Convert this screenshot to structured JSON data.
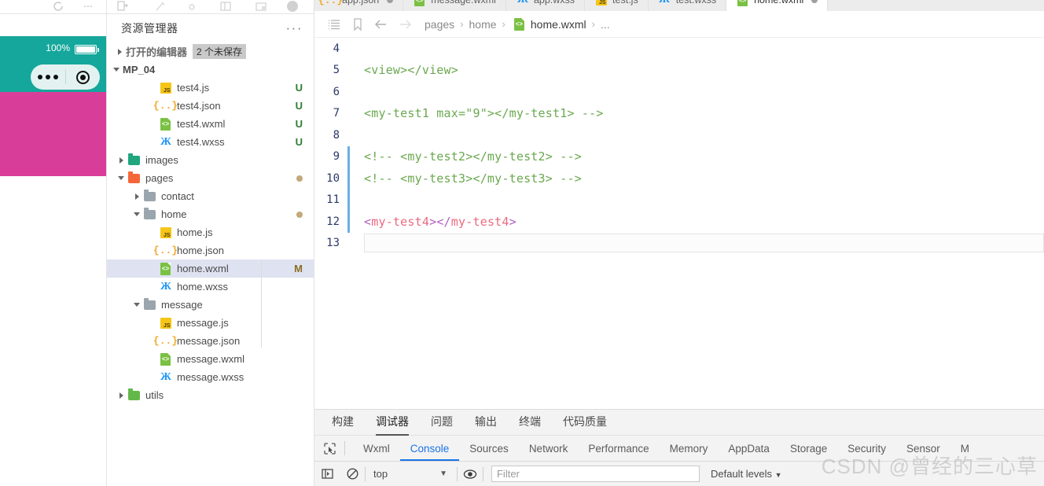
{
  "simulator": {
    "battery_percent": "100%",
    "status_bar_color": "#15a79b",
    "body_color": "#d93d9a"
  },
  "explorer": {
    "title": "资源管理器",
    "more_label": "···",
    "open_editors": {
      "label": "打开的编辑器",
      "badge": "2 个未保存"
    },
    "project": "MP_04",
    "tree": [
      {
        "name": "test4.js",
        "icon": "js-file-icon",
        "indent": 3,
        "git": "U",
        "type": "file"
      },
      {
        "name": "test4.json",
        "icon": "json-file-icon",
        "indent": 3,
        "git": "U",
        "type": "file"
      },
      {
        "name": "test4.wxml",
        "icon": "wxml-file-icon",
        "indent": 3,
        "git": "U",
        "type": "file"
      },
      {
        "name": "test4.wxss",
        "icon": "wxss-file-icon",
        "indent": 3,
        "git": "U",
        "type": "file"
      },
      {
        "name": "images",
        "icon": "folder-icon",
        "indent": 1,
        "git": "",
        "type": "folder",
        "state": "collapsed",
        "color": "green"
      },
      {
        "name": "pages",
        "icon": "folder-icon",
        "indent": 1,
        "git": "",
        "type": "folder",
        "state": "expanded",
        "color": "orange",
        "modified": true
      },
      {
        "name": "contact",
        "icon": "folder-icon",
        "indent": 2,
        "git": "",
        "type": "folder",
        "state": "collapsed",
        "color": "grey"
      },
      {
        "name": "home",
        "icon": "folder-icon",
        "indent": 2,
        "git": "",
        "type": "folder",
        "state": "expanded",
        "color": "grey",
        "modified": true
      },
      {
        "name": "home.js",
        "icon": "js-file-icon",
        "indent": 3,
        "git": "",
        "type": "file"
      },
      {
        "name": "home.json",
        "icon": "json-file-icon",
        "indent": 3,
        "git": "",
        "type": "file"
      },
      {
        "name": "home.wxml",
        "icon": "wxml-file-icon",
        "indent": 3,
        "git": "M",
        "type": "file",
        "selected": true
      },
      {
        "name": "home.wxss",
        "icon": "wxss-file-icon",
        "indent": 3,
        "git": "",
        "type": "file"
      },
      {
        "name": "message",
        "icon": "folder-icon",
        "indent": 2,
        "git": "",
        "type": "folder",
        "state": "expanded",
        "color": "grey"
      },
      {
        "name": "message.js",
        "icon": "js-file-icon",
        "indent": 3,
        "git": "",
        "type": "file"
      },
      {
        "name": "message.json",
        "icon": "json-file-icon",
        "indent": 3,
        "git": "",
        "type": "file"
      },
      {
        "name": "message.wxml",
        "icon": "wxml-file-icon",
        "indent": 3,
        "git": "",
        "type": "file"
      },
      {
        "name": "message.wxss",
        "icon": "wxss-file-icon",
        "indent": 3,
        "git": "",
        "type": "file"
      },
      {
        "name": "utils",
        "icon": "folder-icon",
        "indent": 1,
        "git": "",
        "type": "folder",
        "state": "collapsed",
        "color": "lgreen"
      }
    ]
  },
  "tabs": [
    {
      "label": "app.json",
      "icon": "json-file-icon",
      "active": false,
      "dirty": true
    },
    {
      "label": "message.wxml",
      "icon": "wxml-file-icon",
      "active": false,
      "dirty": false
    },
    {
      "label": "app.wxss",
      "icon": "wxss-file-icon",
      "active": false,
      "dirty": false
    },
    {
      "label": "test.js",
      "icon": "js-file-icon",
      "active": false,
      "dirty": false
    },
    {
      "label": "test.wxss",
      "icon": "wxss-file-icon",
      "active": false,
      "dirty": false
    },
    {
      "label": "home.wxml",
      "icon": "wxml-file-icon",
      "active": true,
      "dirty": true
    }
  ],
  "breadcrumb": {
    "items": [
      "pages",
      "home",
      "home.wxml",
      "..."
    ],
    "separator": "›"
  },
  "code": {
    "lines": [
      {
        "num": "4",
        "fold": false,
        "tokens": []
      },
      {
        "num": "5",
        "fold": false,
        "tokens": [
          {
            "t": "<view></view>",
            "c": "c-com"
          }
        ]
      },
      {
        "num": "6",
        "fold": false,
        "tokens": []
      },
      {
        "num": "7",
        "fold": false,
        "tokens": [
          {
            "t": "<my-test1 max=\"9\"></my-test1> -->",
            "c": "c-com"
          }
        ]
      },
      {
        "num": "8",
        "fold": false,
        "tokens": []
      },
      {
        "num": "9",
        "fold": true,
        "tokens": [
          {
            "t": "<!-- <my-test2></my-test2> -->",
            "c": "c-com"
          }
        ]
      },
      {
        "num": "10",
        "fold": true,
        "tokens": [
          {
            "t": "<!-- <my-test3></my-test3> -->",
            "c": "c-com"
          }
        ]
      },
      {
        "num": "11",
        "fold": true,
        "tokens": []
      },
      {
        "num": "12",
        "fold": true,
        "tokens": [
          {
            "t": "<",
            "c": "c-brk"
          },
          {
            "t": "my-test4",
            "c": "c-tag"
          },
          {
            "t": "></",
            "c": "c-brk"
          },
          {
            "t": "my-test4",
            "c": "c-tag"
          },
          {
            "t": ">",
            "c": "c-brk"
          }
        ]
      },
      {
        "num": "13",
        "fold": false,
        "tokens": [],
        "current": true
      }
    ]
  },
  "devtools": {
    "panel_tabs": [
      {
        "label": "构建",
        "active": false
      },
      {
        "label": "调试器",
        "active": true
      },
      {
        "label": "问题",
        "active": false
      },
      {
        "label": "输出",
        "active": false
      },
      {
        "label": "终端",
        "active": false
      },
      {
        "label": "代码质量",
        "active": false
      }
    ],
    "inspector_tabs": [
      {
        "label": "Wxml",
        "active": false
      },
      {
        "label": "Console",
        "active": true
      },
      {
        "label": "Sources",
        "active": false
      },
      {
        "label": "Network",
        "active": false
      },
      {
        "label": "Performance",
        "active": false
      },
      {
        "label": "Memory",
        "active": false
      },
      {
        "label": "AppData",
        "active": false
      },
      {
        "label": "Storage",
        "active": false
      },
      {
        "label": "Security",
        "active": false
      },
      {
        "label": "Sensor",
        "active": false
      },
      {
        "label": "M",
        "active": false
      }
    ],
    "context_selector": "top",
    "filter_placeholder": "Filter",
    "levels_label": "Default levels"
  },
  "watermark": "CSDN @曾经的三心草"
}
